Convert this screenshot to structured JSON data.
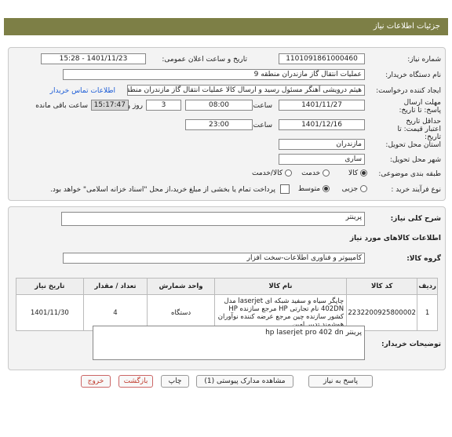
{
  "header": {
    "title": "جزئیات اطلاعات نیاز"
  },
  "info": {
    "need_number_label": "شماره نیاز:",
    "need_number": "1101091861000460",
    "announce_label": "تاریخ و ساعت اعلان عمومی:",
    "announce_value": "1401/11/23 - 15:28",
    "buyer_org_label": "نام دستگاه خریدار:",
    "buyer_org": "عملیات انتقال گاز مازندران منطقه 9",
    "creator_label": "ایجاد کننده درخواست:",
    "creator": "هیثم درویشی آهنگر مسئول رسید و ارسال کالا عملیات انتقال گاز مازندران منطقه",
    "buyer_contact_link": "اطلاعات تماس خریدار",
    "deadline_label": "مهلت ارسال پاسخ: تا تاریخ:",
    "deadline_date": "1401/11/27",
    "time_label": "ساعت",
    "deadline_time": "08:00",
    "days_value": "3",
    "days_label": "روز و",
    "remaining_time": "15:17:47",
    "remaining_label": "ساعت باقی مانده",
    "validity_label": "حداقل تاریخ اعتبار قیمت: تا تاریخ:",
    "validity_date": "1401/12/16",
    "validity_time": "23:00",
    "province_label": "استان محل تحویل:",
    "province": "مازندران",
    "city_label": "شهر محل تحویل:",
    "city": "ساری",
    "category_label": "طبقه بندی موضوعی:",
    "category_options": [
      "کالا",
      "خدمت",
      "کالا/خدمت"
    ],
    "process_label": "نوع فرآیند خرید :",
    "process_options": [
      "جزیی",
      "متوسط"
    ],
    "payment_note": "پرداخت تمام یا بخشی از مبلغ خرید،از محل \"اسناد خزانه اسلامی\" خواهد بود."
  },
  "details": {
    "summary_label": "شرح کلی نیاز:",
    "summary": "پرینتر",
    "goods_title": "اطلاعات کالاهای مورد نیاز",
    "group_label": "گروه کالا:",
    "group": "کامپیوتر و فناوری اطلاعات-سخت افزار",
    "table": {
      "headers": [
        "ردیف",
        "کد کالا",
        "نام کالا",
        "واحد شمارش",
        "تعداد / مقدار",
        "تاریخ نیاز"
      ],
      "rows": [
        {
          "row": "1",
          "code": "2232200925800002",
          "name": "چاپگر سیاه و سفید شبکه ای laserjet مدل 402DN نام تجارتی HP مرجع سازنده HP کشور سازنده چین مرجع عرضه کننده نوآوران هوشمند تدبیر امین",
          "unit": "دستگاه",
          "qty": "4",
          "date": "1401/11/30"
        }
      ]
    },
    "buyer_notes_label": "توضیحات خریدار:",
    "buyer_notes": "پرینتر hp laserjet pro 402 dn"
  },
  "buttons": {
    "reply": "پاسخ به نیاز",
    "docs": "مشاهده مدارک پیوستی (1)",
    "print": "چاپ",
    "back": "بازگشت",
    "exit": "خروج"
  }
}
